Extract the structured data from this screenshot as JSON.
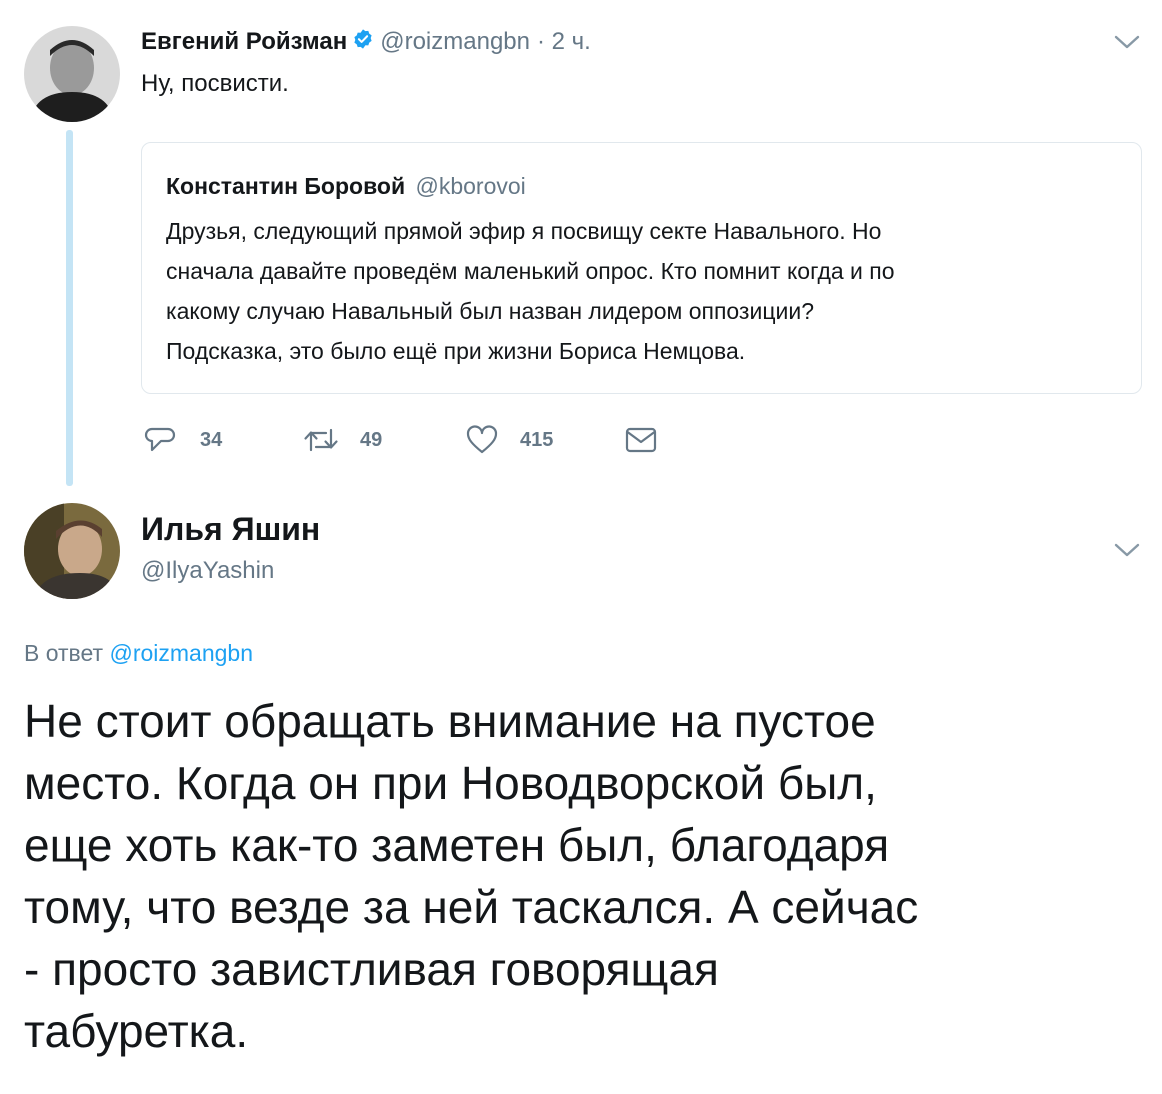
{
  "tweet1": {
    "author_name": "Евгений Ройзман",
    "handle": "@roizmangbn",
    "time": "· 2 ч.",
    "text": "Ну, посвисти.",
    "quoted": {
      "author_name": "Константин Боровой",
      "handle": "@kborovoi",
      "lines": [
        "Друзья, следующий прямой эфир я посвищу секте Навального. Но",
        "сначала давайте проведём маленький опрос. Кто помнит когда и по",
        "какому случаю Навальный был назван лидером оппозиции?",
        "Подсказка, это было ещё при жизни Бориса Немцова."
      ]
    },
    "actions": {
      "replies": "34",
      "retweets": "49",
      "likes": "415"
    }
  },
  "tweet2": {
    "author_name": "Илья Яшин",
    "handle": "@IlyaYashin",
    "reply_prefix": "В ответ",
    "reply_to": "@roizmangbn",
    "lines": [
      "Не стоит обращать внимание на пустое",
      "место. Когда он при Новодворской был,",
      "еще хоть как-то заметен был, благодаря",
      "тому, что везде за ней таскался. А сейчас",
      "- просто завистливая говорящая",
      "табуретка."
    ]
  },
  "colors": {
    "accent": "#1da1f2",
    "muted": "#657786",
    "thread_line": "#c4e4f5",
    "border": "#e1e8ed"
  },
  "icons": [
    "verified-badge-icon",
    "chevron-down-icon",
    "reply-icon",
    "retweet-icon",
    "like-icon",
    "direct-message-icon"
  ]
}
